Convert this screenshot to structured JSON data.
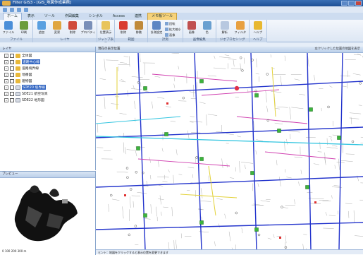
{
  "window": {
    "title": "Filter GIS3 - [GIS_地図作成業務]"
  },
  "tabs": [
    {
      "label": "ホーム",
      "kind": "active"
    },
    {
      "label": "表示",
      "kind": ""
    },
    {
      "label": "ツール",
      "kind": ""
    },
    {
      "label": "作図編集",
      "kind": ""
    },
    {
      "label": "シンボル",
      "kind": ""
    },
    {
      "label": "Access",
      "kind": ""
    },
    {
      "label": "連携",
      "kind": ""
    },
    {
      "label": "メモ帳ツール",
      "kind": "map"
    }
  ],
  "ribbon": {
    "groups": [
      {
        "label": "ファイル",
        "buttons": [
          {
            "label": "ファイル",
            "color": "#4a8ed8"
          },
          {
            "label": "印刷",
            "color": "#6b9c3c"
          }
        ]
      },
      {
        "label": "レイヤ",
        "buttons": [
          {
            "label": "追加",
            "color": "#5aa0e0"
          },
          {
            "label": "変更",
            "color": "#e0a640"
          },
          {
            "label": "削除",
            "color": "#d04a3a"
          },
          {
            "label": "プロパティ",
            "color": "#7a8fb8"
          }
        ]
      },
      {
        "label": "ジャンプ表示",
        "buttons": [
          {
            "label": "位置表示",
            "color": "#e8c45a"
          }
        ]
      },
      {
        "label": "範囲",
        "buttons": [
          {
            "label": "削除",
            "color": "#d93a2e"
          },
          {
            "label": "移動",
            "color": "#c08a3a"
          }
        ]
      },
      {
        "label": "計測",
        "buttons": [
          {
            "label": "計測設定",
            "color": "#5c86c4"
          }
        ]
      },
      {
        "label": "画像編集",
        "buttons": [
          {
            "label": "画像",
            "color": "#c05050"
          },
          {
            "label": "色",
            "color": "#6aa0d0"
          }
        ]
      },
      {
        "label": "ジオプロセシング",
        "buttons": [
          {
            "label": "解析",
            "color": "#b8c8e0"
          },
          {
            "label": "フィルタ",
            "color": "#e8a040"
          }
        ]
      },
      {
        "label": "ヘルプ",
        "buttons": [
          {
            "label": "ヘルプ",
            "color": "#e8b830"
          }
        ]
      }
    ],
    "small_items": [
      "回転",
      "拡大縮小",
      "画像",
      "文字列",
      "選択"
    ]
  },
  "layer_panel": {
    "title": "レイヤ",
    "items": [
      {
        "label": "全体図",
        "type": "folder",
        "selected": false
      },
      {
        "label": "道路中心線",
        "type": "folder",
        "selected": true
      },
      {
        "label": "道路境界線",
        "type": "folder",
        "selected": false
      },
      {
        "label": "地番図",
        "type": "folder",
        "selected": false
      },
      {
        "label": "建物図",
        "type": "folder",
        "selected": false
      },
      {
        "label": "SDE20 境界線",
        "type": "doc",
        "selected": true
      },
      {
        "label": "SDE21 航空写真",
        "type": "doc",
        "selected": false
      },
      {
        "label": "SDE22 地形図",
        "type": "doc",
        "selected": false
      }
    ]
  },
  "preview": {
    "title": "プレビュー",
    "scale": "0 100 200 300 m"
  },
  "map": {
    "header": "現在の表示位置",
    "hint": "左クリックした位置の地図を表示",
    "status": "ヒント：地図をクリックすると表示位置を変更できます"
  }
}
